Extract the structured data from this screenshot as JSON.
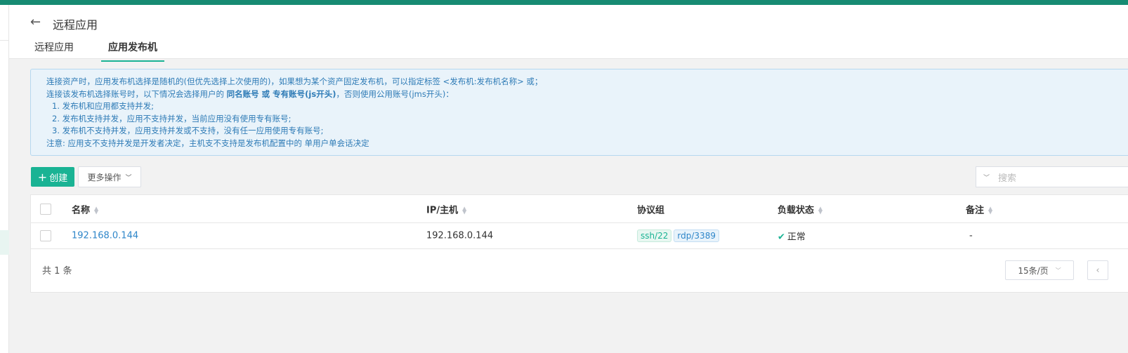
{
  "header": {
    "title": "远程应用",
    "tabs": [
      {
        "label": "远程应用"
      },
      {
        "label": "应用发布机"
      }
    ]
  },
  "info": {
    "line1": "连接资产时，应用发布机选择是随机的(但优先选择上次使用的)，如果想为某个资产固定发布机，可以指定标签 <发布机:发布机名称> 或；",
    "line2_a": "连接该发布机选择账号时，以下情况会选择用户的 ",
    "line2_b": "同名账号 或 专有账号(js开头)",
    "line2_c": "，否则使用公用账号(jms开头)：",
    "items": [
      "1. 发布机和应用都支持并发;",
      "2. 发布机支持并发，应用不支持并发，当前应用没有使用专有账号;",
      "3. 发布机不支持并发，应用支持并发或不支持，没有任一应用使用专有账号;"
    ],
    "note": "注意: 应用支不支持并发是开发者决定，主机支不支持是发布机配置中的 单用户单会话决定"
  },
  "toolbar": {
    "create": "创建",
    "more": "更多操作",
    "search_placeholder": "搜索"
  },
  "table": {
    "columns": [
      "名称",
      "IP/主机",
      "协议组",
      "负载状态",
      "备注"
    ],
    "rows": [
      {
        "name": "192.168.0.144",
        "ip": "192.168.0.144",
        "protocols": [
          "ssh/22",
          "rdp/3389"
        ],
        "status": "正常",
        "comment": "-"
      }
    ],
    "total": "共 1 条",
    "page_size": "15条/页"
  }
}
